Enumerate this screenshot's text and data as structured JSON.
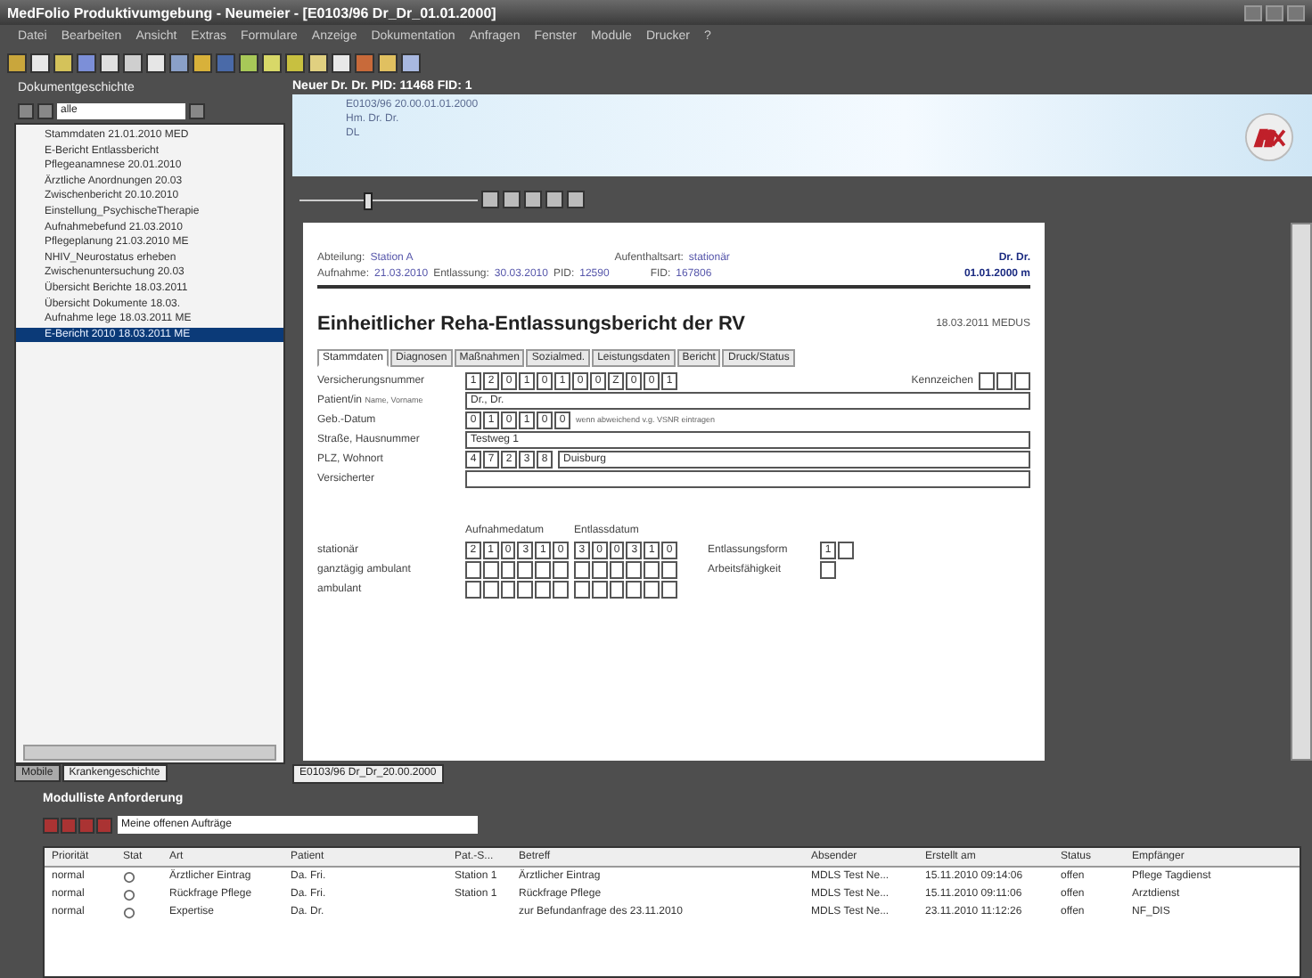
{
  "window": {
    "title": "MedFolio Produktivumgebung - Neumeier - [E0103/96 Dr_Dr_01.01.2000]"
  },
  "menu": [
    "Datei",
    "Bearbeiten",
    "Ansicht",
    "Extras",
    "Formulare",
    "Anzeige",
    "Dokumentation",
    "Anfragen",
    "Fenster",
    "Module",
    "Drucker",
    "?"
  ],
  "sidebar": {
    "title": "Dokumentgeschichte",
    "filter": "alle",
    "items": [
      {
        "label": "Stammdaten 21.01.2010 MED",
        "selected": false
      },
      {
        "label": "E-Bericht Entlassbericht",
        "selected": false
      },
      {
        "label": "Pflegeanamnese 20.01.2010",
        "selected": false
      },
      {
        "label": "Ärztliche Anordnungen 20.03",
        "selected": false
      },
      {
        "label": "Zwischenbericht 20.10.2010",
        "selected": false
      },
      {
        "label": "Einstellung_PsychischeTherapie",
        "selected": false
      },
      {
        "label": "Aufnahmebefund 21.03.2010",
        "selected": false
      },
      {
        "label": "Pflegeplanung 21.03.2010 ME",
        "selected": false
      },
      {
        "label": "NHIV_Neurostatus erheben",
        "selected": false
      },
      {
        "label": "Zwischenuntersuchung 20.03",
        "selected": false
      },
      {
        "label": "Übersicht Berichte 18.03.2011",
        "selected": false
      },
      {
        "label": "Übersicht Dokumente 18.03.",
        "selected": false
      },
      {
        "label": "Aufnahme lege 18.03.2011 ME",
        "selected": false
      },
      {
        "label": "E-Bericht 2010 18.03.2011 ME",
        "selected": true
      }
    ],
    "tabs": [
      {
        "label": "Mobile",
        "selected": false
      },
      {
        "label": "Krankengeschichte",
        "selected": true
      }
    ]
  },
  "header": {
    "title": "Neuer Dr. Dr. PID: 11468 FID: 1",
    "banner_lines": [
      "E0103/96 20.00.01.01.2000",
      "Hm. Dr. Dr.",
      "DL"
    ]
  },
  "document": {
    "abteilung_label": "Abteilung:",
    "abteilung": "Station A",
    "aufenthalt_label": "Aufenthaltsart:",
    "aufenthalt": "stationär",
    "aufnahme_label": "Aufnahme:",
    "aufnahme": "21.03.2010",
    "entlassung_label": "Entlassung:",
    "entlassung": "30.03.2010",
    "pid_label": "PID:",
    "pid": "12590",
    "fid_label": "FID:",
    "fid": "167806",
    "patient_name": "Dr. Dr.",
    "patient_birth": "01.01.2000  m",
    "title": "Einheitlicher Reha-Entlassungsbericht der RV",
    "date": "18.03.2011 MEDUS",
    "tabs": [
      {
        "label": "Stammdaten",
        "selected": true
      },
      {
        "label": "Diagnosen",
        "selected": false
      },
      {
        "label": "Maßnahmen",
        "selected": false
      },
      {
        "label": "Sozialmed.",
        "selected": false
      },
      {
        "label": "Leistungsdaten",
        "selected": false
      },
      {
        "label": "Bericht",
        "selected": false
      },
      {
        "label": "Druck/Status",
        "selected": false
      }
    ],
    "versicherungsnummer_label": "Versicherungsnummer",
    "versicherungsnummer": [
      "1",
      "2",
      "0",
      "1",
      "0",
      "1",
      "0",
      "0",
      "Z",
      "0",
      "0",
      "1"
    ],
    "kennzeichen_label": "Kennzeichen",
    "patient_label": "Patient/in",
    "name_hint": "Name, Vorname",
    "name": "Dr., Dr.",
    "geburt_label": "Geb.-Datum",
    "geburt": [
      "0",
      "1",
      "0",
      "1",
      "0",
      "0"
    ],
    "geburt_hint": "wenn abweichend v.g. VSNR eintragen",
    "strasse_label": "Straße, Hausnummer",
    "strasse": "Testweg 1",
    "plz_label": "PLZ, Wohnort",
    "plz": [
      "4",
      "7",
      "2",
      "3",
      "8"
    ],
    "ort": "Duisburg",
    "versicherter_label": "Versicherter",
    "aufnahmedatum_label": "Aufnahmedatum",
    "entlassdatum_label": "Entlassdatum",
    "stays": [
      {
        "label": "stationär",
        "from": [
          "2",
          "1",
          "0",
          "3",
          "1",
          "0"
        ],
        "to": [
          "3",
          "0",
          "0",
          "3",
          "1",
          "0"
        ]
      },
      {
        "label": "ganztägig ambulant"
      },
      {
        "label": "ambulant"
      }
    ],
    "entlassungsform_label": "Entlassungsform",
    "entlassungsform": "1",
    "arbeitsfaehigkeit_label": "Arbeitsfähigkeit"
  },
  "zoom": {
    "level": 0.38
  },
  "doc_tab": "E0103/96 Dr_Dr_20.00.2000",
  "tasks": {
    "title": "Modulliste Anforderung",
    "filter": "Meine offenen Aufträge",
    "columns": [
      "Priorität",
      "Stat",
      "Art",
      "Patient",
      "Pat.-S...",
      "Betreff",
      "Absender",
      "Erstellt am",
      "Status",
      "Empfänger"
    ],
    "rows": [
      [
        "normal",
        "",
        "Ärztlicher Eintrag",
        "Da. Fri.",
        "Station 1",
        "Ärztlicher Eintrag",
        "MDLS Test Ne...",
        "15.11.2010 09:14:06",
        "offen",
        "Pflege Tagdienst"
      ],
      [
        "normal",
        "",
        "Rückfrage Pflege",
        "Da. Fri.",
        "Station 1",
        "Rückfrage Pflege",
        "MDLS Test Ne...",
        "15.11.2010 09:11:06",
        "offen",
        "Arztdienst"
      ],
      [
        "normal",
        "",
        "Expertise",
        "Da. Dr.",
        "",
        "zur Befundanfrage des 23.11.2010",
        "MDLS Test Ne...",
        "23.11.2010 11:12:26",
        "offen",
        "NF_DIS"
      ]
    ]
  }
}
